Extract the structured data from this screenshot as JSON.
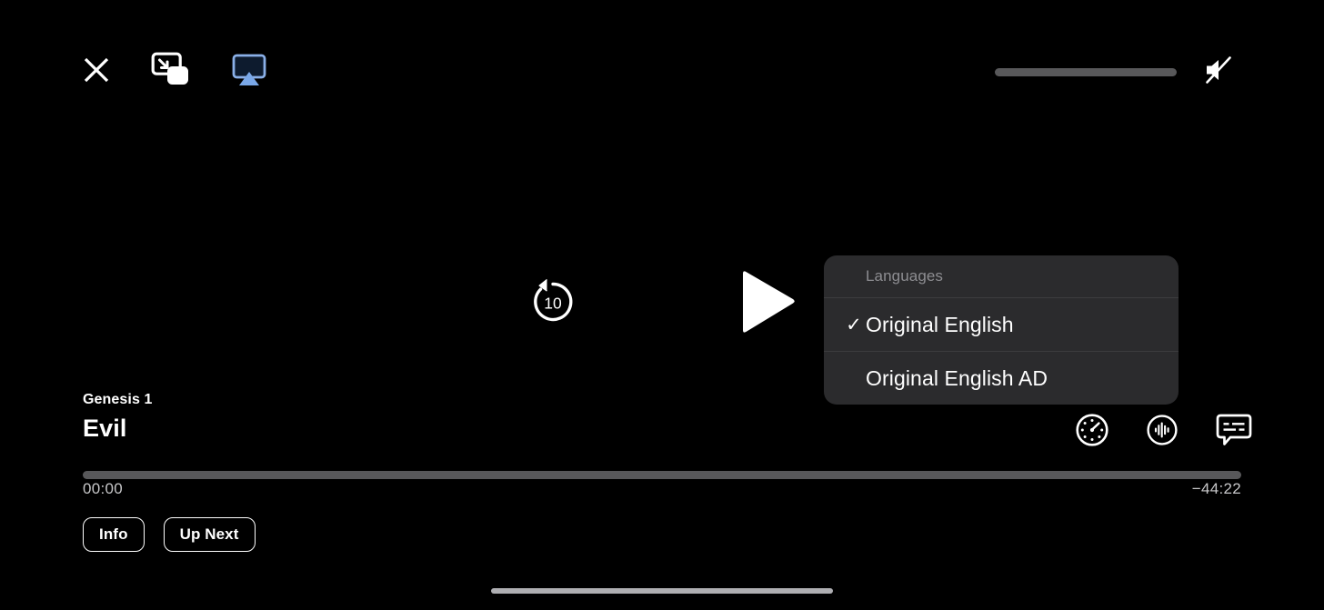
{
  "player": {
    "background_color": "#000000",
    "top_bar": {
      "close": {
        "icon": "close-x-icon",
        "label": "Close"
      },
      "pip": {
        "icon": "picture-in-picture-icon",
        "label": "Picture in Picture"
      },
      "airplay": {
        "icon": "airplay-icon",
        "label": "AirPlay",
        "color": "#8ab0e8",
        "active": "true"
      },
      "volume": {
        "icon": "mute-speaker-icon",
        "label": "Mute",
        "muted": "true",
        "level_percent": 0,
        "track_color": "#58585a"
      }
    },
    "center_controls": {
      "skip_back": {
        "icon": "skip-back-10-icon",
        "label": "Skip back",
        "seconds": "10"
      },
      "play": {
        "icon": "play-triangle-icon",
        "label": "Play",
        "state": "paused"
      }
    },
    "languages_menu": {
      "header": "Languages",
      "background_color": "#2b2b2d",
      "items": [
        {
          "label": "Original English",
          "checked": true,
          "check_glyph": "✓"
        },
        {
          "label": "Original English AD",
          "checked": false,
          "check_glyph": "✓"
        }
      ]
    },
    "meta": {
      "subtitle": "Genesis 1",
      "title": "Evil"
    },
    "bottom_right_icons": [
      {
        "icon": "playback-speed-icon",
        "label": "Playback Speed"
      },
      {
        "icon": "audio-waveform-icon",
        "label": "Audio"
      },
      {
        "icon": "subtitles-bubble-icon",
        "label": "Subtitles"
      }
    ],
    "scrubber": {
      "progress_percent": 0,
      "elapsed": "00:00",
      "remaining": "−44:22",
      "track_color": "#58585a",
      "fill_color": "#ffffff"
    },
    "pill_buttons": [
      {
        "label": "Info"
      },
      {
        "label": "Up Next"
      }
    ],
    "home_indicator": {
      "label": "Home Indicator",
      "color": "#aeaeb2"
    }
  }
}
